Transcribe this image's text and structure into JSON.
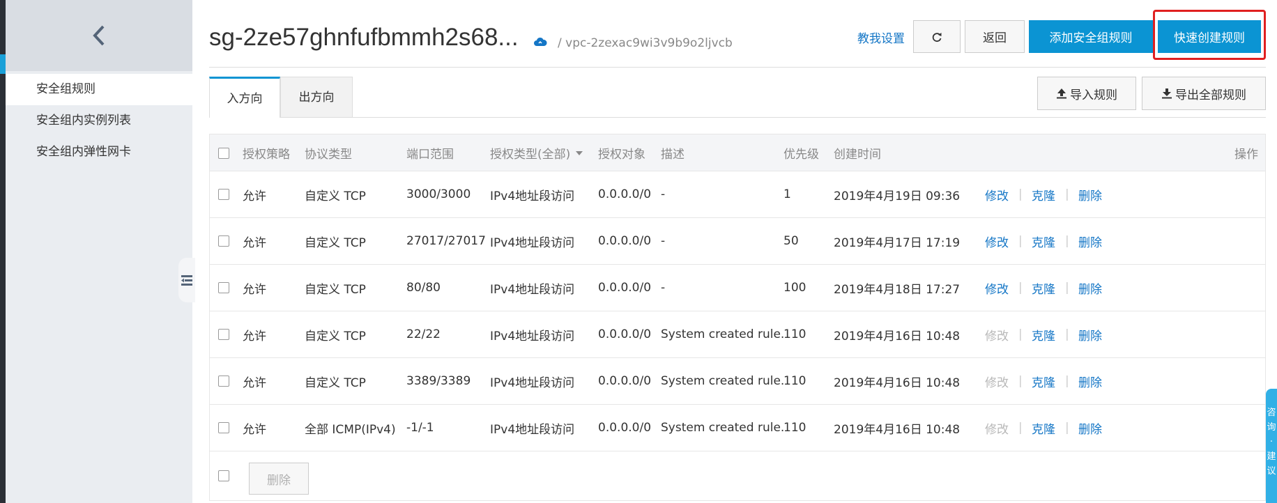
{
  "sidebar": {
    "items": [
      {
        "label": "安全组规则",
        "active": true
      },
      {
        "label": "安全组内实例列表",
        "active": false
      },
      {
        "label": "安全组内弹性网卡",
        "active": false
      }
    ]
  },
  "header": {
    "title": "sg-2ze57ghnfufbmmh2s68...",
    "vpc": "/ vpc-2zexac9wi3v9b9o2ljvcb",
    "teach_link": "教我设置",
    "back_label": "返回",
    "add_label": "添加安全组规则",
    "quick_label": "快速创建规则"
  },
  "tabs": [
    {
      "label": "入方向",
      "active": true
    },
    {
      "label": "出方向",
      "active": false
    }
  ],
  "toolbar": {
    "import_label": "导入规则",
    "export_label": "导出全部规则"
  },
  "table": {
    "columns": [
      "授权策略",
      "协议类型",
      "端口范围",
      "授权类型(全部)",
      "授权对象",
      "描述",
      "优先级",
      "创建时间",
      "操作"
    ],
    "rows": [
      {
        "policy": "允许",
        "protocol": "自定义 TCP",
        "port": "3000/3000",
        "auth_type": "IPv4地址段访问",
        "object": "0.0.0.0/0",
        "desc": "-",
        "priority": "1",
        "created": "2019年4月19日 09:36",
        "edit": "修改",
        "clone": "克隆",
        "delete": "删除",
        "edit_disabled": false
      },
      {
        "policy": "允许",
        "protocol": "自定义 TCP",
        "port": "27017/27017",
        "auth_type": "IPv4地址段访问",
        "object": "0.0.0.0/0",
        "desc": "-",
        "priority": "50",
        "created": "2019年4月17日 17:19",
        "edit": "修改",
        "clone": "克隆",
        "delete": "删除",
        "edit_disabled": false
      },
      {
        "policy": "允许",
        "protocol": "自定义 TCP",
        "port": "80/80",
        "auth_type": "IPv4地址段访问",
        "object": "0.0.0.0/0",
        "desc": "-",
        "priority": "100",
        "created": "2019年4月18日 17:27",
        "edit": "修改",
        "clone": "克隆",
        "delete": "删除",
        "edit_disabled": false
      },
      {
        "policy": "允许",
        "protocol": "自定义 TCP",
        "port": "22/22",
        "auth_type": "IPv4地址段访问",
        "object": "0.0.0.0/0",
        "desc": "System created rule.",
        "priority": "110",
        "created": "2019年4月16日 10:48",
        "edit": "修改",
        "clone": "克隆",
        "delete": "删除",
        "edit_disabled": true
      },
      {
        "policy": "允许",
        "protocol": "自定义 TCP",
        "port": "3389/3389",
        "auth_type": "IPv4地址段访问",
        "object": "0.0.0.0/0",
        "desc": "System created rule.",
        "priority": "110",
        "created": "2019年4月16日 10:48",
        "edit": "修改",
        "clone": "克隆",
        "delete": "删除",
        "edit_disabled": true
      },
      {
        "policy": "允许",
        "protocol": "全部 ICMP(IPv4)",
        "port": "-1/-1",
        "auth_type": "IPv4地址段访问",
        "object": "0.0.0.0/0",
        "desc": "System created rule.",
        "priority": "110",
        "created": "2019年4月16日 10:48",
        "edit": "修改",
        "clone": "克隆",
        "delete": "删除",
        "edit_disabled": true
      }
    ],
    "footer_delete_label": "删除"
  },
  "consult": {
    "label": "咨询·建议"
  },
  "colors": {
    "primary": "#0b94d3",
    "link": "#1476c6",
    "highlight_box": "#e02020"
  }
}
